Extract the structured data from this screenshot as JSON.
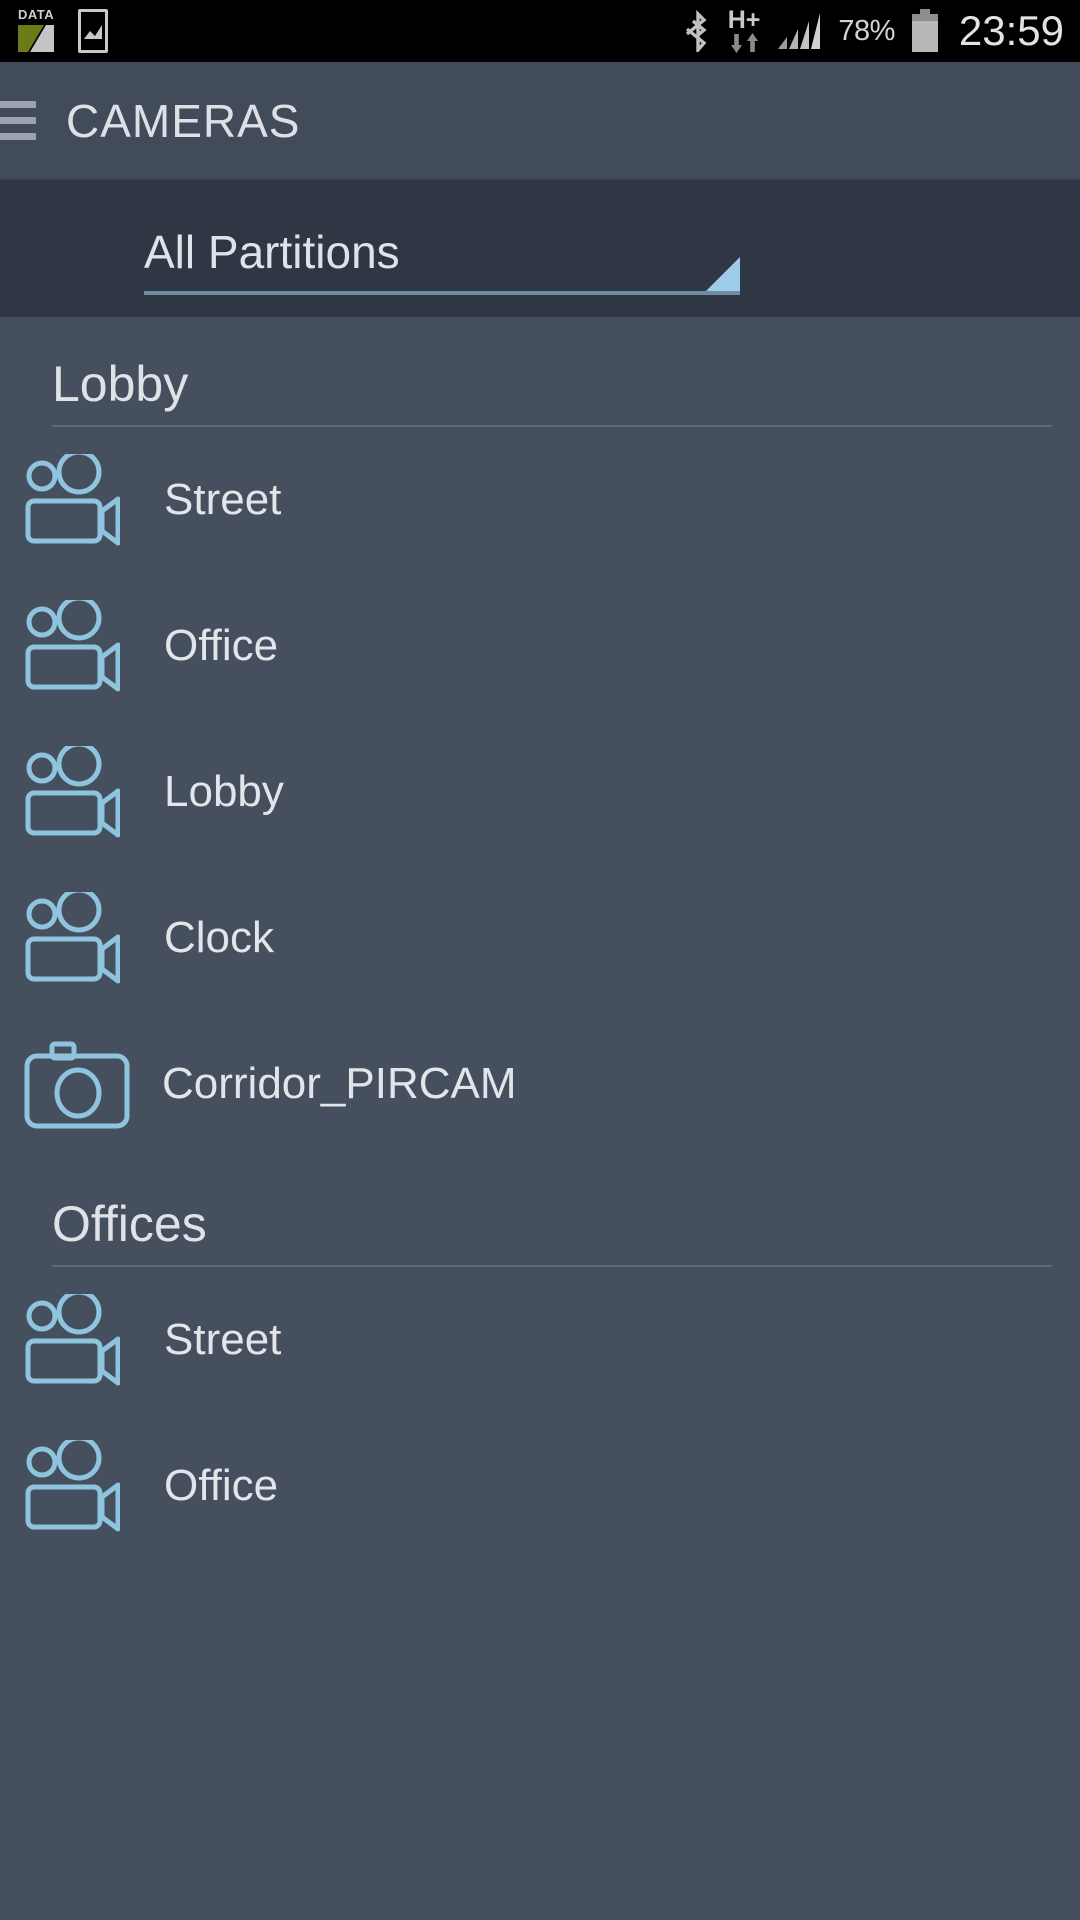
{
  "statusbar": {
    "data_icon_label": "DATA",
    "network_type": "H+",
    "battery_percent": "78%",
    "clock": "23:59",
    "icons": [
      "data-usage-icon",
      "screenshot-icon",
      "bluetooth-icon",
      "hsdpa-data-icon",
      "signal-bars-icon",
      "battery-icon"
    ]
  },
  "actionbar": {
    "menu_icon": "hamburger-menu-icon",
    "title": "CAMERAS"
  },
  "spinner": {
    "selected": "All Partitions",
    "arrow_icon": "dropdown-triangle-icon",
    "accent_color": "#9cccea",
    "underline_color": "#6e8da3"
  },
  "sections": [
    {
      "title": "Lobby",
      "items": [
        {
          "label": "Street",
          "icon": "camcorder-icon"
        },
        {
          "label": "Office",
          "icon": "camcorder-icon"
        },
        {
          "label": "Lobby",
          "icon": "camcorder-icon"
        },
        {
          "label": "Clock",
          "icon": "camcorder-icon"
        },
        {
          "label": "Corridor_PIRCAM",
          "icon": "photo-camera-icon"
        }
      ]
    },
    {
      "title": "Offices",
      "items": [
        {
          "label": "Street",
          "icon": "camcorder-icon"
        },
        {
          "label": "Office",
          "icon": "camcorder-icon"
        }
      ]
    }
  ],
  "colors": {
    "statusbar_bg": "#000000",
    "actionbar_bg": "#414b59",
    "spinner_bg": "#2f3744",
    "list_bg": "#454f5d",
    "icon_blue": "#8fc4de",
    "text_primary": "#e2e6ea"
  }
}
